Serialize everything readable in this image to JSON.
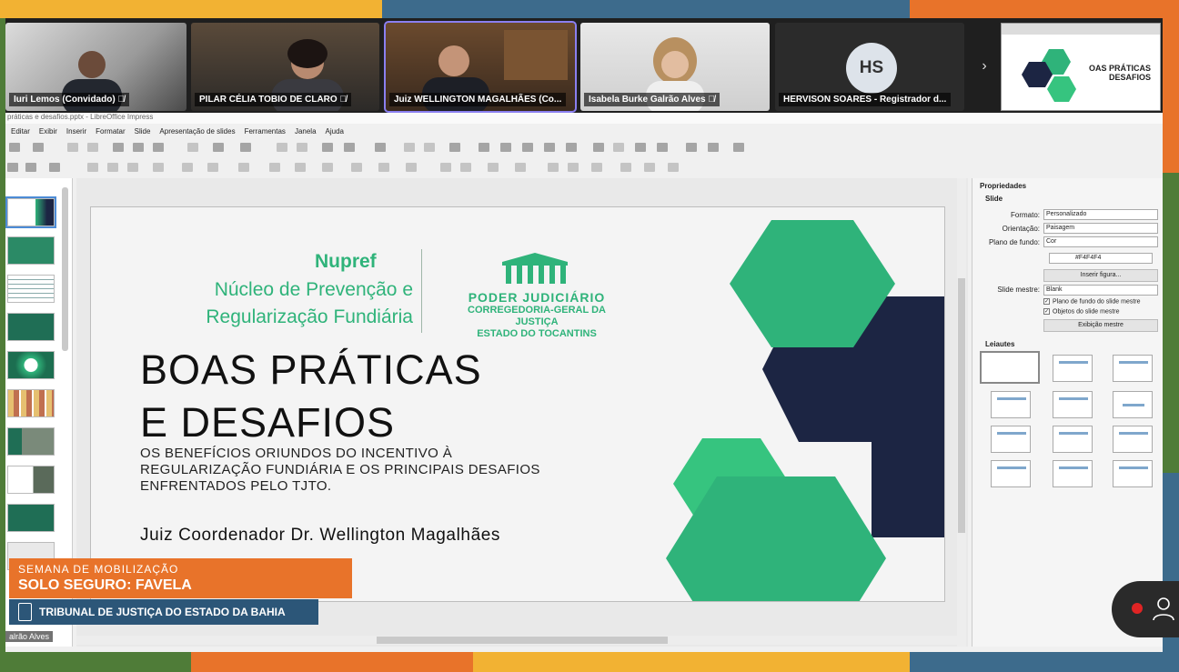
{
  "participants": [
    {
      "name": "Iuri Lemos (Convidado)",
      "muted": true,
      "active": false
    },
    {
      "name": "PILAR CÉLIA TOBIO DE CLARO",
      "muted": true,
      "active": false
    },
    {
      "name": "Juiz WELLINGTON MAGALHÃES (Co...",
      "muted": false,
      "active": true
    },
    {
      "name": "Isabela Burke Galrão Alves",
      "muted": true,
      "active": false
    },
    {
      "name": "HERVISON SOARES - Registrador d...",
      "initials": "HS",
      "active": false
    }
  ],
  "shared_thumbnail": {
    "text_lines": [
      "OAS PRÁTICAS",
      "DESAFIOS"
    ]
  },
  "window": {
    "title": "práticas e desafios.pptx - LibreOffice Impress"
  },
  "menu": [
    "Editar",
    "Exibir",
    "Inserir",
    "Formatar",
    "Slide",
    "Apresentação de slides",
    "Ferramentas",
    "Janela",
    "Ajuda"
  ],
  "slide": {
    "nupref": "Nupref",
    "nucleo_lines": [
      "Núcleo de Prevenção e",
      "Regularização Fundiária"
    ],
    "pj_lines": [
      "PODER JUDICIÁRIO",
      "CORREGEDORIA-GERAL DA JUSTIÇA",
      "ESTADO DO TOCANTINS"
    ],
    "title_lines": [
      "BOAS PRÁTICAS",
      "E DESAFIOS"
    ],
    "subtitle_lines": [
      "OS BENEFÍCIOS ORIUNDOS DO INCENTIVO À",
      "REGULARIZAÇÃO FUNDIÁRIA E OS PRINCIPAIS DESAFIOS",
      "ENFRENTADOS PELO TJTO."
    ],
    "presenter": "Juiz Coordenador Dr. Wellington Magalhães",
    "colors": {
      "green": "#2fb37a",
      "light_green": "#36c47f",
      "navy": "#1c2543",
      "bg": "#f4f4f4"
    }
  },
  "sidebar": {
    "title": "Propriedades",
    "section_slide": "Slide",
    "formato_label": "Formato:",
    "formato_value": "Personalizado",
    "orientacao_label": "Orientação:",
    "orientacao_value": "Paisagem",
    "plano_label": "Plano de fundo:",
    "plano_value": "Cor",
    "color_value": "#F4F4F4",
    "inserir_figura": "Inserir figura...",
    "slide_mestre_label": "Slide mestre:",
    "slide_mestre_value": "Blank",
    "check_plano": "Plano de fundo do slide mestre",
    "check_objetos": "Objetos do slide mestre",
    "exibicao_mestre": "Exibição mestre",
    "section_layouts": "Leiautes"
  },
  "overlay": {
    "semana": "SEMANA DE MOBILIZAÇÃO",
    "solo": "SOLO SEGURO: FAVELA",
    "tribunal": "TRIBUNAL DE JUSTIÇA DO ESTADO DA BAHIA",
    "name_tag": "alrão Alves"
  }
}
